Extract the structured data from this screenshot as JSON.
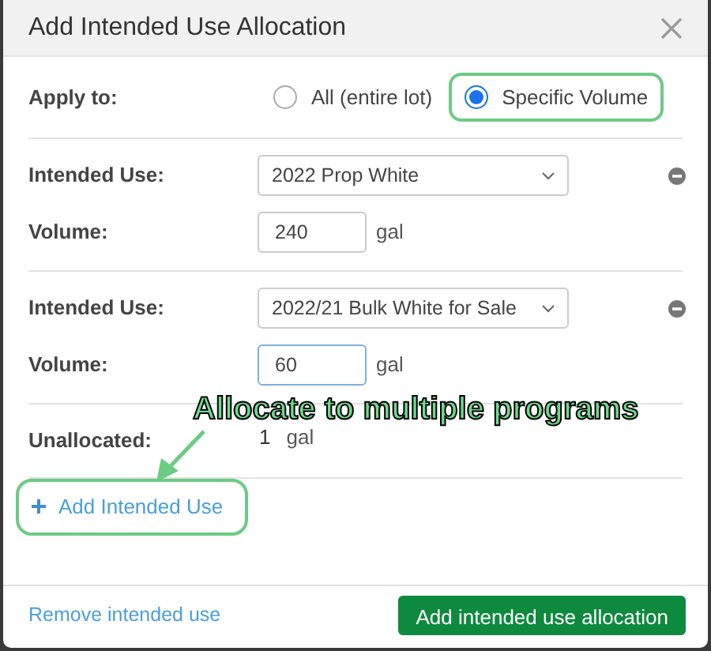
{
  "dialog": {
    "title": "Add Intended Use Allocation"
  },
  "apply_to": {
    "label": "Apply to:",
    "options": [
      {
        "label": "All (entire lot)",
        "selected": false,
        "highlighted": false
      },
      {
        "label": "Specific Volume",
        "selected": true,
        "highlighted": true
      }
    ]
  },
  "allocations": [
    {
      "use_label": "Intended Use:",
      "use_value": "2022 Prop White",
      "volume_label": "Volume:",
      "volume": "240",
      "unit": "gal",
      "focused": false
    },
    {
      "use_label": "Intended Use:",
      "use_value": "2022/21 Bulk White for Sale",
      "volume_label": "Volume:",
      "volume": "60",
      "unit": "gal",
      "focused": true
    }
  ],
  "unallocated": {
    "label": "Unallocated:",
    "value": "1",
    "unit": "gal"
  },
  "add_link": {
    "label": "Add Intended Use",
    "highlighted": true
  },
  "annotation": {
    "text": "Allocate to multiple programs"
  },
  "footer": {
    "remove_link": "Remove intended use",
    "submit": "Add intended use allocation"
  }
}
